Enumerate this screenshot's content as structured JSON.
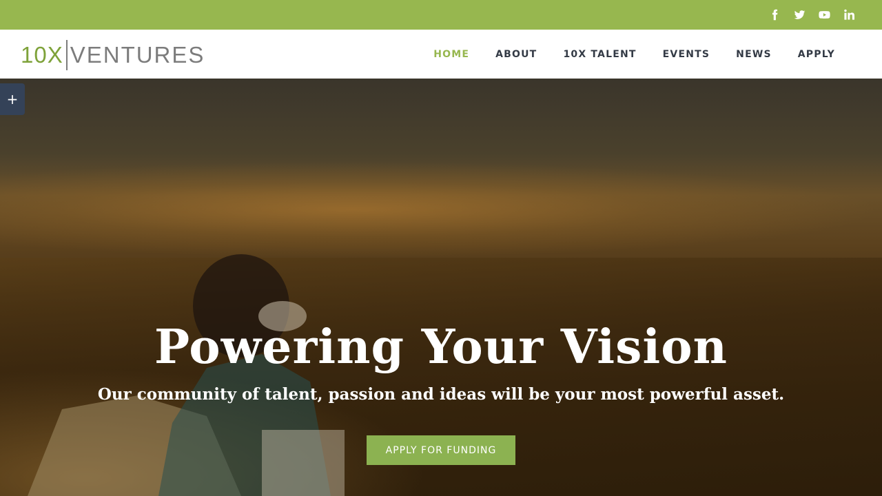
{
  "topbar": {
    "social": [
      {
        "icon": "facebook-icon"
      },
      {
        "icon": "twitter-icon"
      },
      {
        "icon": "youtube-icon"
      },
      {
        "icon": "linkedin-icon"
      }
    ],
    "color": "#97b74f"
  },
  "logo": {
    "part1": "10X",
    "part2": "VENTURES"
  },
  "nav": {
    "items": [
      {
        "label": "HOME",
        "active": true
      },
      {
        "label": "ABOUT",
        "active": false
      },
      {
        "label": "10X TALENT",
        "active": false
      },
      {
        "label": "EVENTS",
        "active": false
      },
      {
        "label": "NEWS",
        "active": false
      },
      {
        "label": "APPLY",
        "active": false
      }
    ],
    "active_color": "#97b74f"
  },
  "hero": {
    "title": "Powering Your Vision",
    "subtitle": "Our community of talent, passion and ideas will be your most powerful asset.",
    "cta_label": "APPLY FOR FUNDING"
  },
  "sidebar_toggle": {
    "label": "+"
  }
}
